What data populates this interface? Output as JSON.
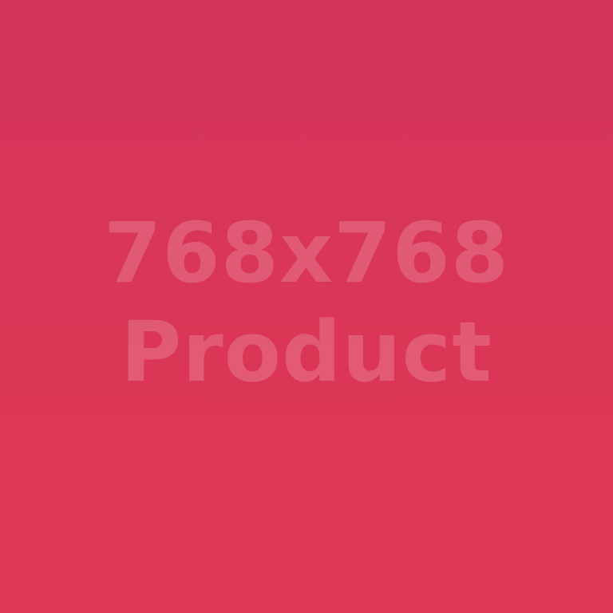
{
  "placeholder": {
    "dimensions_text": "768x768",
    "label_text": "Product"
  },
  "colors": {
    "background_top": "#d3355b",
    "background_bottom": "#e03656",
    "text": "rgba(255,255,255,0.18)"
  }
}
